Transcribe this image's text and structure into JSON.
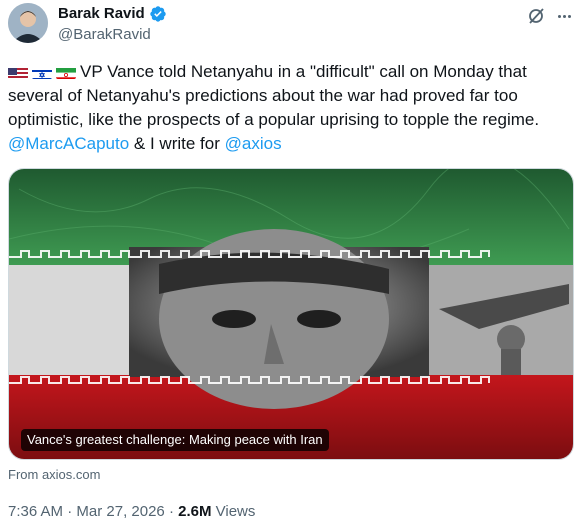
{
  "author": {
    "name": "Barak Ravid",
    "handle": "@BarakRavid",
    "avatar_icon": "avatar-photo",
    "verified_icon": "verified-badge-icon"
  },
  "header_actions": {
    "grok_icon": "grok-icon",
    "more_icon": "more-options-icon"
  },
  "tweet": {
    "flags": [
      "us-flag",
      "israel-flag",
      "iran-flag"
    ],
    "text_main": "VP Vance told Netanyahu in a \"difficult\" call on Monday that several of Netanyahu's predictions about the war had proved far too optimistic, like the prospects of a popular uprising to topple the regime.",
    "mention_1": "@MarcACaputo",
    "connector": " & I write for ",
    "mention_2": "@axios"
  },
  "card": {
    "caption": "Vance's greatest challenge: Making peace with Iran",
    "source": "From axios.com"
  },
  "meta": {
    "time": "7:36 AM",
    "separator": " · ",
    "date": "Mar 27, 2026",
    "views_count": "2.6M",
    "views_label": " Views"
  },
  "colors": {
    "accent": "#1d9bf0",
    "secondary_text": "#536471",
    "iran_green": "#239f40",
    "iran_red": "#da0000"
  }
}
